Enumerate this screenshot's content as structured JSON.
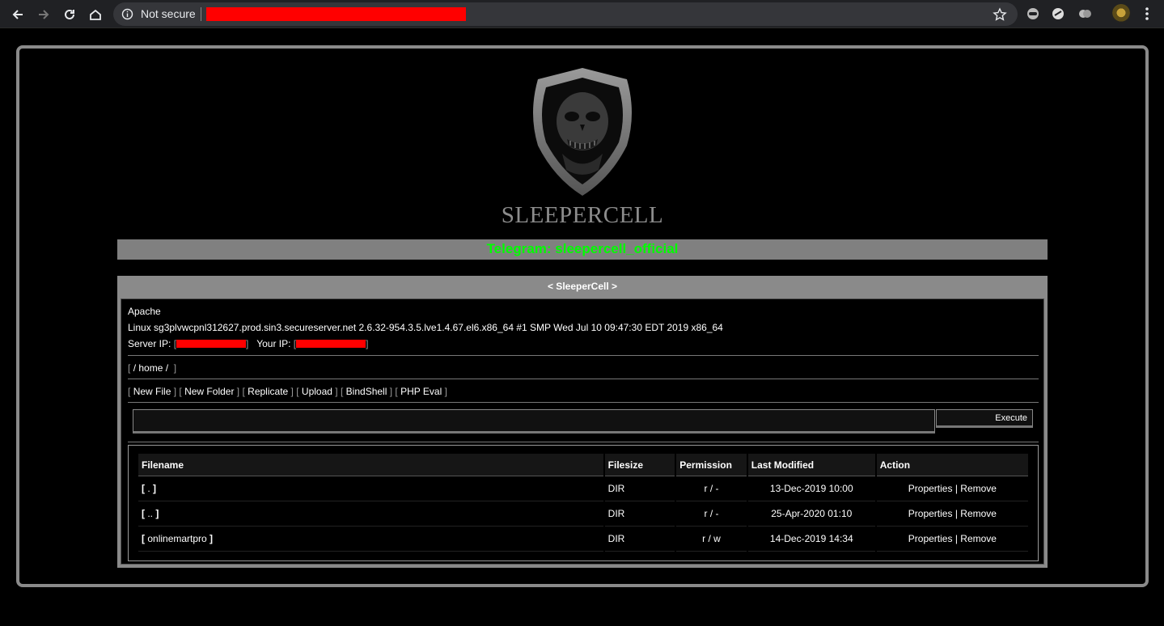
{
  "browser": {
    "security_label": "Not secure"
  },
  "page": {
    "brand": "SLEEPERCELL",
    "telegram": "Telegram: sleepercell_official",
    "panel_title": "< SleeperCell >",
    "server_software": "Apache",
    "uname": "Linux sg3plvwcpnl312627.prod.sin3.secureserver.net 2.6.32-954.3.5.lve1.4.67.el6.x86_64 #1 SMP Wed Jul 10 09:47:30 EDT 2019 x86_64",
    "server_ip_label": "Server IP:",
    "your_ip_label": "Your IP:",
    "path": "/ home /",
    "actions": {
      "new_file": "New File",
      "new_folder": "New Folder",
      "replicate": "Replicate",
      "upload": "Upload",
      "bindshell": "BindShell",
      "php_eval": "PHP Eval"
    },
    "execute_label": "Execute",
    "table": {
      "headers": [
        "Filename",
        "Filesize",
        "Permission",
        "Last Modified",
        "Action"
      ],
      "rows": [
        {
          "name": ".",
          "size": "DIR",
          "perm": "r / -",
          "modified": "13-Dec-2019 10:00",
          "properties": "Properties",
          "remove": "Remove"
        },
        {
          "name": "..",
          "size": "DIR",
          "perm": "r / -",
          "modified": "25-Apr-2020 01:10",
          "properties": "Properties",
          "remove": "Remove"
        },
        {
          "name": "onlinemartpro",
          "size": "DIR",
          "perm": "r / w",
          "modified": "14-Dec-2019 14:34",
          "properties": "Properties",
          "remove": "Remove"
        }
      ]
    }
  },
  "colors": {
    "telegram_text": "#00ff00",
    "panel_gray": "#8a8a8a",
    "redaction": "#ff0000"
  }
}
